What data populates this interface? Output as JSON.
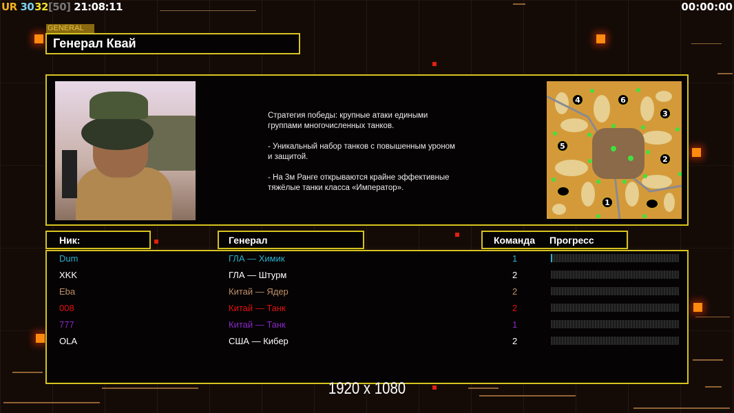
{
  "hud": {
    "ur_label": "UR",
    "val1": "30",
    "val2": "32",
    "bracket": "[50]",
    "clock": "21:08:11",
    "timer": "00:00:00"
  },
  "general": {
    "tag": "GENERAL",
    "name": "Генерал Квай",
    "description": "Стратегия победы: крупные атаки едиными\n группами многочисленных танков.\n\n- Уникальный набор танков с повышенным уроном\n и защитой.\n\n- На 3м Ранге открываются крайне эффективные\n тяжёлые танки класса «Император».",
    "map_start_positions": [
      "1",
      "2",
      "3",
      "4",
      "5",
      "6"
    ]
  },
  "table": {
    "headers": {
      "nick": "Ник:",
      "general": "Генерал",
      "team": "Команда",
      "progress": "Прогресс"
    },
    "rows": [
      {
        "nick": "Dum",
        "general": "ГЛА — Химик",
        "team": "1",
        "progress": 1,
        "color": "#2ab0d0"
      },
      {
        "nick": "XKK",
        "general": "ГЛА — Штурм",
        "team": "2",
        "progress": 0,
        "color": "#ffffff"
      },
      {
        "nick": "Eba",
        "general": "Китай — Ядер",
        "team": "2",
        "progress": 0,
        "color": "#c0906a"
      },
      {
        "nick": "008",
        "general": "Китай — Танк",
        "team": "2",
        "progress": 0,
        "color": "#e41010"
      },
      {
        "nick": "777",
        "general": "Китай — Танк",
        "team": "1",
        "progress": 0,
        "color": "#8a28c8"
      },
      {
        "nick": "OLA",
        "general": "США — Кибер",
        "team": "2",
        "progress": 0,
        "color": "#ffffff"
      }
    ]
  },
  "resolution": "1920 x 1080",
  "colors": {
    "border": "#d8c420",
    "accent": "#ff8a10"
  }
}
